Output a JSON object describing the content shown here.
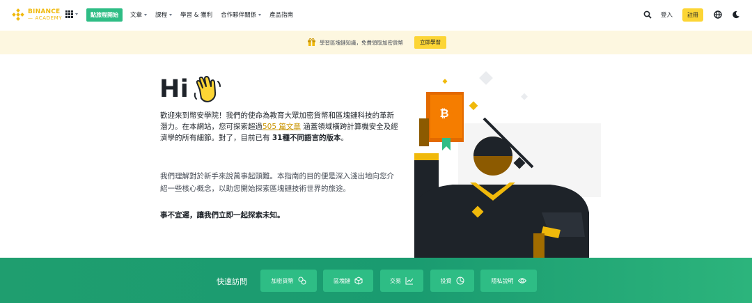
{
  "nav": {
    "logo_line1": "BINANCE",
    "logo_line2": "ACADEMY",
    "cta_label": "點旅程開始",
    "menu": [
      {
        "label": "文章",
        "has_dropdown": true
      },
      {
        "label": "課程",
        "has_dropdown": true
      },
      {
        "label": "學習 & 獲利",
        "has_dropdown": false
      },
      {
        "label": "合作夥伴關係",
        "has_dropdown": true
      },
      {
        "label": "產品指南",
        "has_dropdown": false
      }
    ],
    "login_label": "登入",
    "register_label": "註冊",
    "icons": [
      "apps-grid-icon",
      "search-icon",
      "globe-icon",
      "moon-icon"
    ]
  },
  "banner": {
    "text": "學習區塊鏈知識，免費領取加密貨幣",
    "button_label": "立即學習",
    "icon": "gift-icon"
  },
  "hero": {
    "greeting": "Hi",
    "para1_before": "歡迎來到幣安學院！我們的使命為教育大眾加密貨幣和區塊鏈科技的革新潛力。在本網站，您可探索超過",
    "para1_link": "505 篇文章",
    "para1_middle": " 涵蓋領域橫跨計算機安全及經濟學的所有細節。對了，目前已有 ",
    "para1_bold": "31種不同語言的版本",
    "para1_end": "。",
    "para2": "我們理解對於新手來說萬事起頭難。本指南的目的便是深入淺出地向您介紹一些核心概念，以助您開始探索區塊鏈技術世界的旅途。",
    "para3": "事不宜遲，讓我們立即一起探索未知。"
  },
  "quick": {
    "title": "快速訪問",
    "buttons": [
      {
        "label": "加密貨幣",
        "icon": "coins-icon"
      },
      {
        "label": "區塊鏈",
        "icon": "cube-icon"
      },
      {
        "label": "交易",
        "icon": "chart-line-icon"
      },
      {
        "label": "投資",
        "icon": "pie-chart-icon"
      },
      {
        "label": "隱私說明",
        "icon": "eye-icon"
      }
    ]
  },
  "colors": {
    "brand_yellow": "#f0b90b",
    "button_yellow": "#fcd535",
    "green": "#2ebd85",
    "banner_bg": "#fdf7e0",
    "quick_bg": "#1f9e6f",
    "link": "#c99400"
  }
}
